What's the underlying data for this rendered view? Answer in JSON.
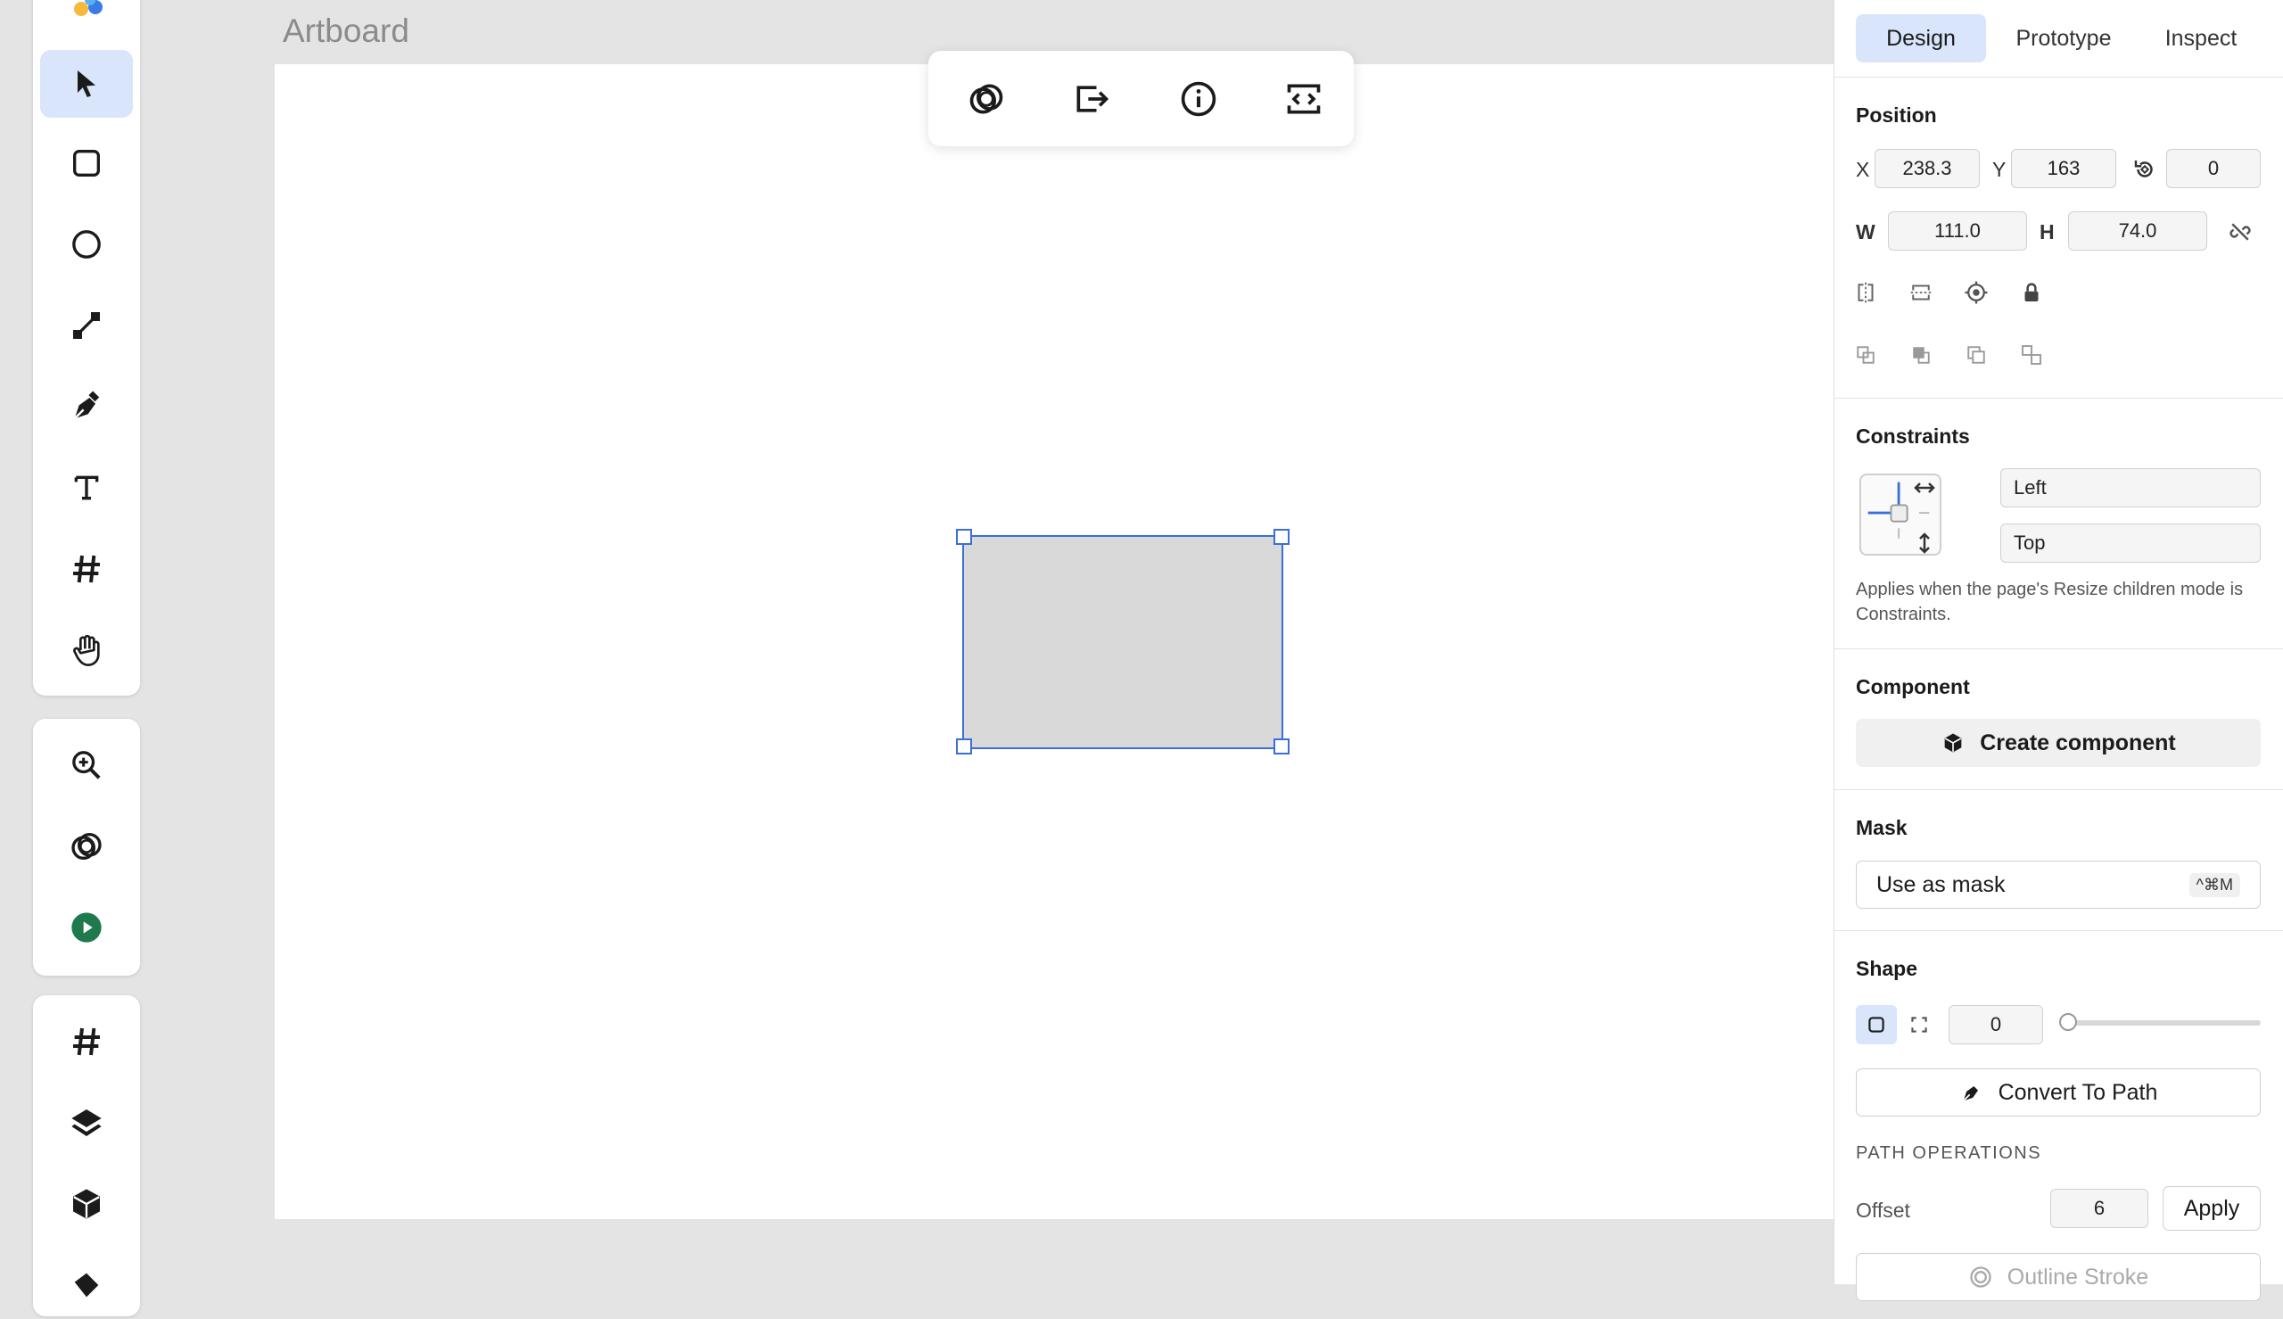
{
  "canvas": {
    "artboard_label": "Artboard"
  },
  "toolbar": {
    "tools": [
      {
        "name": "select-tool",
        "icon": "cursor-icon",
        "active": true
      },
      {
        "name": "rectangle-tool",
        "icon": "square-icon"
      },
      {
        "name": "ellipse-tool",
        "icon": "circle-icon"
      },
      {
        "name": "line-tool",
        "icon": "line-icon"
      },
      {
        "name": "pen-tool",
        "icon": "pen-icon"
      },
      {
        "name": "text-tool",
        "icon": "text-icon"
      },
      {
        "name": "frame-tool",
        "icon": "hash-icon"
      },
      {
        "name": "hand-tool",
        "icon": "hand-icon"
      }
    ],
    "view_tools": [
      {
        "name": "zoom-tool",
        "icon": "zoom-in-icon"
      },
      {
        "name": "boolean-tool",
        "icon": "rings-icon"
      },
      {
        "name": "play-tool",
        "icon": "play-icon"
      }
    ],
    "panel_tools": [
      {
        "name": "frames-panel",
        "icon": "hash-icon"
      },
      {
        "name": "layers-panel",
        "icon": "layers-icon"
      },
      {
        "name": "components-panel",
        "icon": "cube-icon"
      }
    ]
  },
  "floating_toolbar": {
    "buttons": [
      "boolean-icon",
      "export-icon",
      "info-icon",
      "code-icon"
    ]
  },
  "panel": {
    "tabs": [
      {
        "label": "Design",
        "active": true
      },
      {
        "label": "Prototype"
      },
      {
        "label": "Inspect"
      }
    ],
    "position": {
      "title": "Position",
      "x_label": "X",
      "x": "238.3",
      "y_label": "Y",
      "y": "163",
      "rotation": "0",
      "w_label": "W",
      "w": "111.0",
      "h_label": "H",
      "h": "74.0"
    },
    "constraints": {
      "title": "Constraints",
      "horizontal": "Left",
      "vertical": "Top",
      "help": "Applies when the page's Resize children mode is Constraints."
    },
    "component": {
      "title": "Component",
      "button": "Create component"
    },
    "mask": {
      "title": "Mask",
      "button": "Use as mask",
      "shortcut": "^⌘M"
    },
    "shape": {
      "title": "Shape",
      "corner_radius": "0",
      "slider_fraction": 0,
      "convert_button": "Convert To Path"
    },
    "path_operations": {
      "title": "PATH OPERATIONS",
      "offset_label": "Offset",
      "offset_value": "6",
      "apply_button": "Apply",
      "outline_button": "Outline Stroke"
    }
  },
  "colors": {
    "accent": "#3a6ed8",
    "selected_bg": "#d9e5fb",
    "play_green": "#1e7a4c"
  }
}
